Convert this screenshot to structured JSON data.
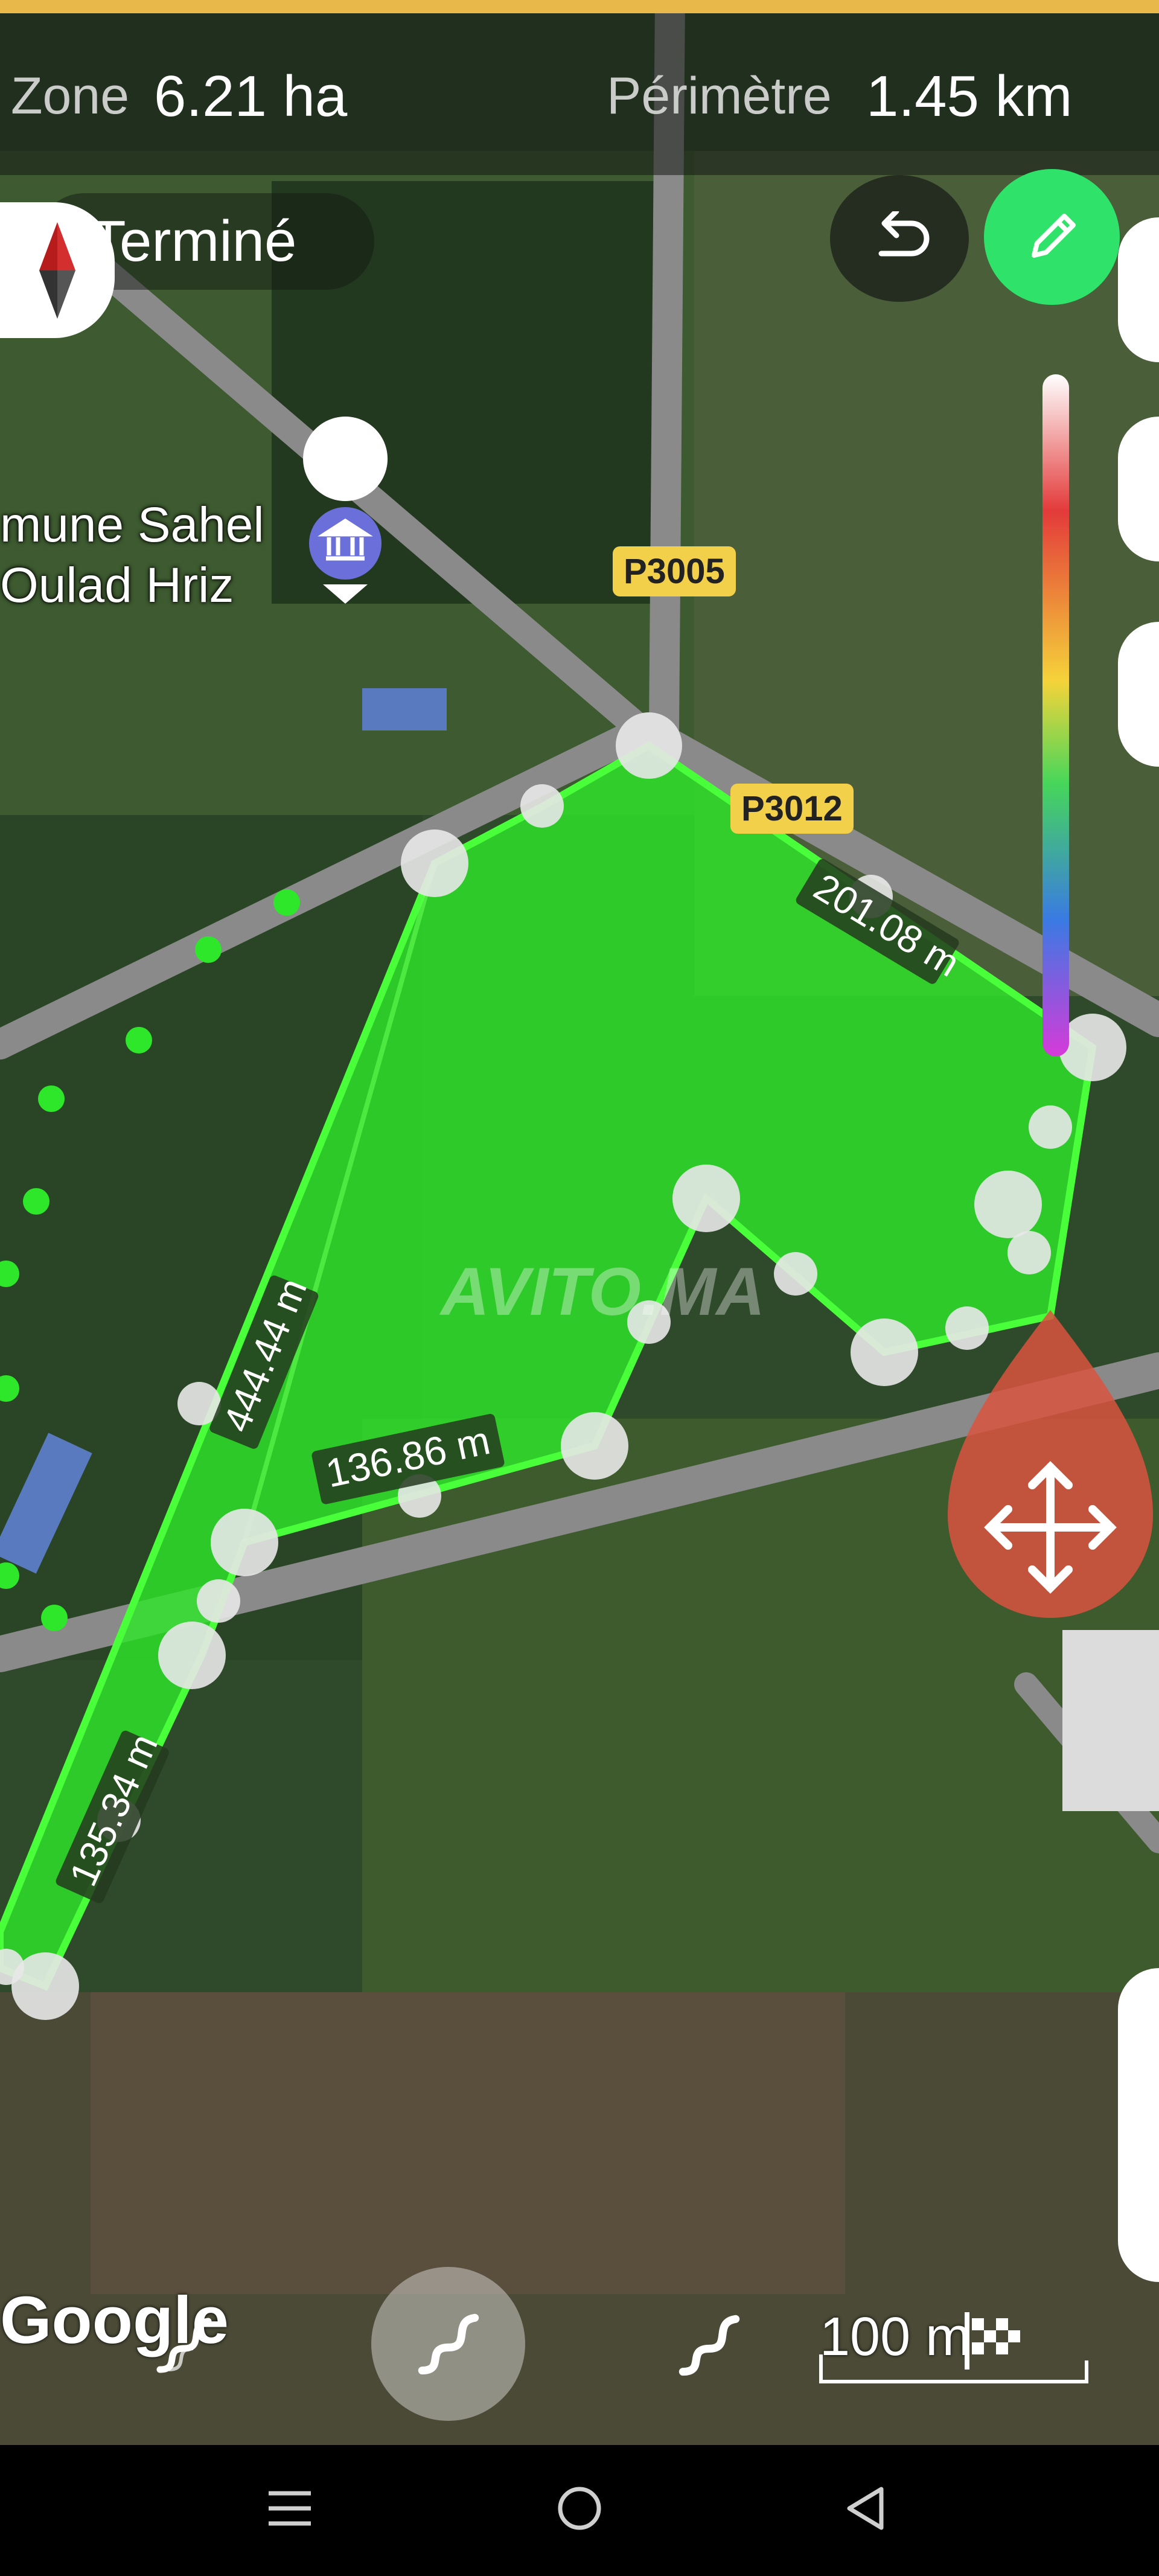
{
  "stats": {
    "zone_label": "Zone",
    "zone_value": "6.21 ha",
    "perimeter_label": "Périmètre",
    "perimeter_value": "1.45 km"
  },
  "toolbar": {
    "done_label": "Terminé",
    "undo_icon": "undo-icon",
    "edit_icon": "pencil-icon",
    "compass_icon": "compass-icon"
  },
  "map": {
    "place_line1": "mune Sahel",
    "place_line2": "Oulad Hriz",
    "road_1": "P3005",
    "road_2": "P3012",
    "measure_1": "201.08 m",
    "measure_2": "444.44 m",
    "measure_3": "136.86 m",
    "measure_4": "135.34 m",
    "watermark": "AVITO.MA",
    "attribution": "Google",
    "scale": "100 m",
    "polygon_color": "#2ee62a",
    "move_handle_color": "#d9533f"
  },
  "bottom_tools": [
    "route-icon",
    "route-icon-selected",
    "route-icon",
    "checkered-flag-icon"
  ],
  "navbar": [
    "menu-icon",
    "home-circle-icon",
    "back-triangle-icon"
  ],
  "colors": {
    "edit_button": "#2fe36a",
    "gradient": [
      "#ffffff",
      "#e33a3a",
      "#f5d33a",
      "#46d65a",
      "#3a7ae3",
      "#d63ad9"
    ]
  }
}
